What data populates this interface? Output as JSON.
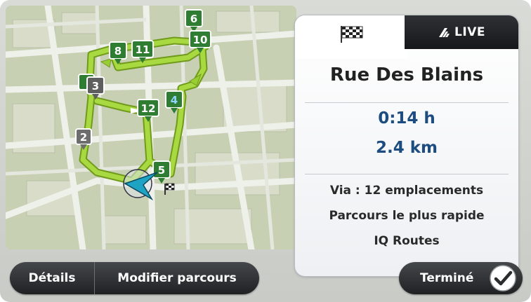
{
  "route_panel": {
    "live_tab_label": "LIVE",
    "destination": "Rue Des Blains",
    "travel_time": "0:14 h",
    "distance": "2.4 km",
    "via": "Via : 12 emplacements",
    "route_type": "Parcours le plus rapide",
    "routing_tech": "IQ Routes"
  },
  "map": {
    "waypoints": [
      "2",
      "3",
      "4",
      "5",
      "6",
      "8",
      "10",
      "11",
      "12"
    ]
  },
  "buttons": {
    "details": "Détails",
    "modify_route": "Modifier parcours",
    "done": "Terminé"
  },
  "colors": {
    "route": "#9acd32",
    "waypoint_green": "#2e7d32",
    "waypoint_gray": "#6d6d6d",
    "accent_value": "#1d4c80",
    "button_dark": "#26282a"
  },
  "icons": [
    "checkered-flag-icon",
    "live-signal-icon",
    "car-position-icon",
    "destination-flag-icon",
    "checkmark-icon"
  ]
}
